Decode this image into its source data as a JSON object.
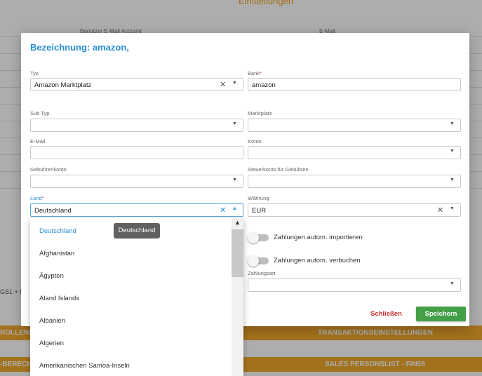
{
  "background": {
    "title": "Einstellungen",
    "col_user_email": "Benutzer E-Mail Account",
    "col_email": "E-Mail",
    "side_text": "GS1 + N",
    "bar1_left": "ROLLENE",
    "bar1_right": "TRANSAKTIONSEINSTELLUNGEN",
    "bar2_left": "-BERECHT",
    "bar2_right": "SALES PERSONSLIST - FIN55"
  },
  "modal": {
    "title_prefix": "Bezeichnung:",
    "title_value": "amazon,",
    "fields": {
      "typ": {
        "label": "Typ",
        "value": "Amazon Marktplatz"
      },
      "bank": {
        "label": "Bank",
        "value": "amazon"
      },
      "sub_typ": {
        "label": "Sub Typ",
        "value": ""
      },
      "marktplatz": {
        "label": "Marktplatz",
        "value": ""
      },
      "email": {
        "label": "E-Mail",
        "value": ""
      },
      "konto": {
        "label": "Konto",
        "value": ""
      },
      "gebuehrenkonto": {
        "label": "Gebührenkonto",
        "value": ""
      },
      "steuerkonto": {
        "label": "Steuerkonto für Gebühren",
        "value": ""
      },
      "land": {
        "label": "Land",
        "value": "Deutschland"
      },
      "waehrung": {
        "label": "Währung",
        "value": "EUR"
      },
      "zahlungsart": {
        "label": "Zahlungsart",
        "value": ""
      }
    },
    "required_mark": "*",
    "toggles": {
      "import": {
        "label": "Zahlungen autom. importieren",
        "on": false
      },
      "book": {
        "label": "Zahlungen autom. verbuchen",
        "on": false
      }
    },
    "buttons": {
      "close": "Schließen",
      "save": "Speichern"
    },
    "icons": {
      "clear": "close-icon",
      "dropdown": "chevron-down-icon"
    }
  },
  "dropdown": {
    "items": [
      "Deutschland",
      "Afghanistan",
      "Ägypten",
      "Aland Islands",
      "Albanien",
      "Algerien",
      "Amerikanischen Samoa-Inseln"
    ],
    "selected": "Deutschland",
    "tooltip": "Deutschland"
  },
  "colors": {
    "accent": "#2a8fd4",
    "save": "#43a047",
    "close": "#d32f2f",
    "bar": "#f0a82b"
  }
}
